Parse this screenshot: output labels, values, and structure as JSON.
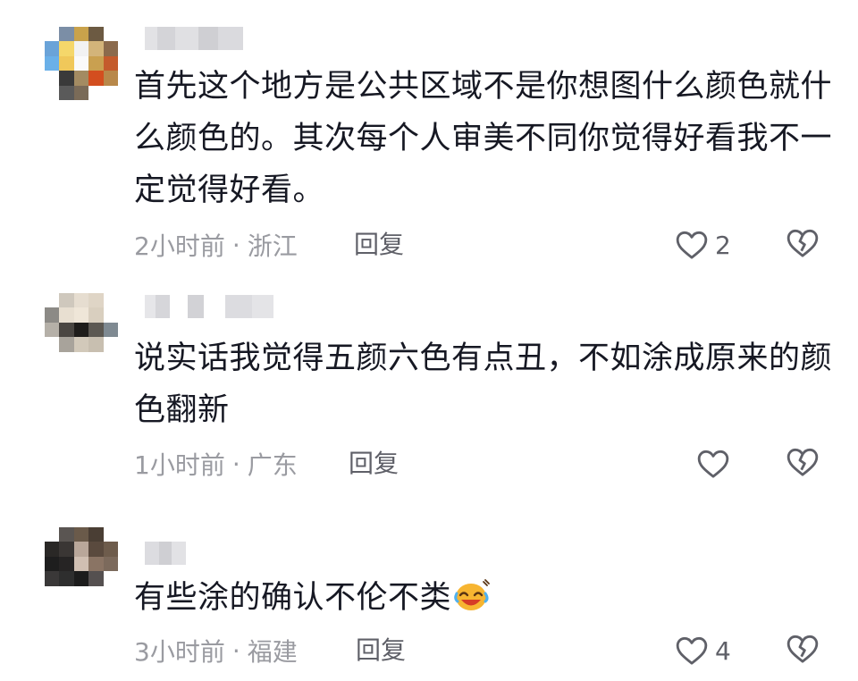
{
  "comments": [
    {
      "text": "首先这个地方是公共区域不是你想图什么颜色就什么颜色的。其次每个人审美不同你觉得好看我不一定觉得好看。",
      "time": "2小时前",
      "location": "浙江",
      "reply_label": "回复",
      "like_count": "2",
      "avatar_colors": [
        "#ffffff",
        "#7b8ea6",
        "#c9a24b",
        "#6c5a42",
        "#ffffff",
        "#6aa3d8",
        "#f5d76a",
        "#f2f2f2",
        "#d3b47a",
        "#8b6a4c",
        "#6ab0e8",
        "#f0c85a",
        "#fafafa",
        "#c9a050",
        "#c45b2c",
        "#ffffff",
        "#3a3a3a",
        "#a38b62",
        "#d34e1f",
        "#b8884a",
        "#ffffff",
        "#5a5a5a",
        "#7a6b58",
        "#ffffff",
        "#ffffff"
      ]
    },
    {
      "text": "说实话我觉得五颜六色有点丑，不如涂成原来的颜色翻新",
      "time": "1小时前",
      "location": "广东",
      "reply_label": "回复",
      "like_count": "",
      "avatar_colors": [
        "#ffffff",
        "#cfc8bd",
        "#e6ddd0",
        "#dfd5c6",
        "#ffffff",
        "#8c8a86",
        "#e8dfd1",
        "#efe6d8",
        "#d9cfbf",
        "#ffffff",
        "#b5b0a8",
        "#4a4642",
        "#1f1d1b",
        "#5c5852",
        "#7f8a92",
        "#ffffff",
        "#a8a39b",
        "#d2c9ba",
        "#c8bfb0",
        "#ffffff",
        "#ffffff",
        "#ffffff",
        "#ffffff",
        "#ffffff",
        "#ffffff"
      ]
    },
    {
      "text": "有些涂的确认不伦不类",
      "time": "3小时前",
      "location": "福建",
      "reply_label": "回复",
      "like_count": "4",
      "avatar_colors": [
        "#ffffff",
        "#5a5552",
        "#6a5a4a",
        "#4a3e34",
        "#ffffff",
        "#2a2826",
        "#3a3634",
        "#b9a79a",
        "#5a4a3e",
        "#6e5c4c",
        "#1e1e1e",
        "#262424",
        "#d0bfb2",
        "#8a7464",
        "#7c6a5c",
        "#3a3838",
        "#2e2e2e",
        "#1c1c1c",
        "#555050",
        "#ffffff",
        "#ffffff",
        "#ffffff",
        "#ffffff",
        "#ffffff",
        "#ffffff"
      ]
    }
  ],
  "colors": {
    "text": "#161823",
    "meta": "#9a9ba1",
    "action": "#5f6068",
    "blur_name": "#d9d9dc"
  },
  "icons": [
    "heart-outline-icon",
    "broken-heart-icon",
    "laughing-tears-emoji"
  ]
}
